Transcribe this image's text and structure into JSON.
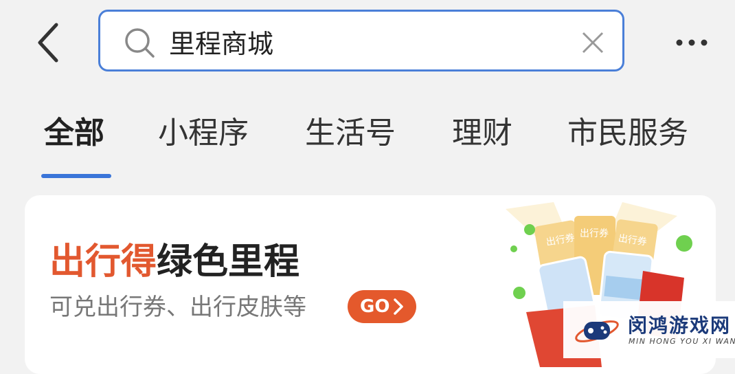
{
  "header": {
    "search": {
      "value": "里程商城"
    }
  },
  "tabs": [
    {
      "label": "全部",
      "active": true
    },
    {
      "label": "小程序",
      "active": false
    },
    {
      "label": "生活号",
      "active": false
    },
    {
      "label": "理财",
      "active": false
    },
    {
      "label": "市民服务",
      "active": false
    }
  ],
  "card": {
    "title_highlight": "出行得",
    "title_rest": "绿色里程",
    "subtitle": "可兑出行券、出行皮肤等",
    "go_label": "GO",
    "illustration_labels": [
      "出行券",
      "出行券",
      "出行券"
    ]
  },
  "watermark": {
    "cn": "闵鸿游戏网",
    "en": "MIN HONG YOU XI WANG"
  },
  "colors": {
    "accent_blue": "#3a75d9",
    "orange": "#e2582f",
    "background": "#f2f2f2"
  }
}
